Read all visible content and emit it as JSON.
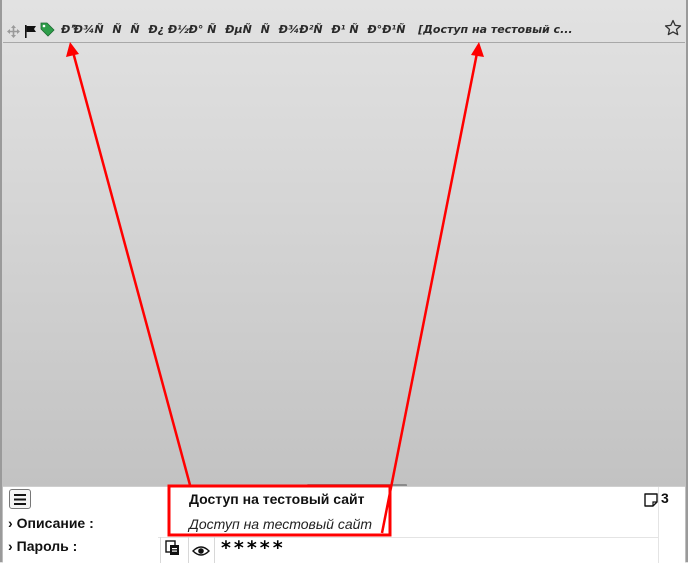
{
  "top_bar": {
    "title": "ÐÐ¾ÑÑÑÐ¿ Ð½Ð° ÑÐµÑÑÐ¾Ð²ÑÐ¹ ÑÐ°Ð¹Ñ [Доступ на тестовый с...",
    "icons": [
      "move-icon",
      "flag-icon",
      "tag-icon",
      "star-icon"
    ]
  },
  "panel": {
    "title": "Доступ на тестовый сайт",
    "note_count": "3",
    "rows": [
      {
        "label": "Описание :",
        "value": "Доступ на тестовый сайт"
      },
      {
        "label": "Пароль :",
        "value": "*****"
      }
    ]
  },
  "colors": {
    "annotation": "#ff0000",
    "flag_color": "#111111",
    "tag_color": "#2e9e4a"
  }
}
